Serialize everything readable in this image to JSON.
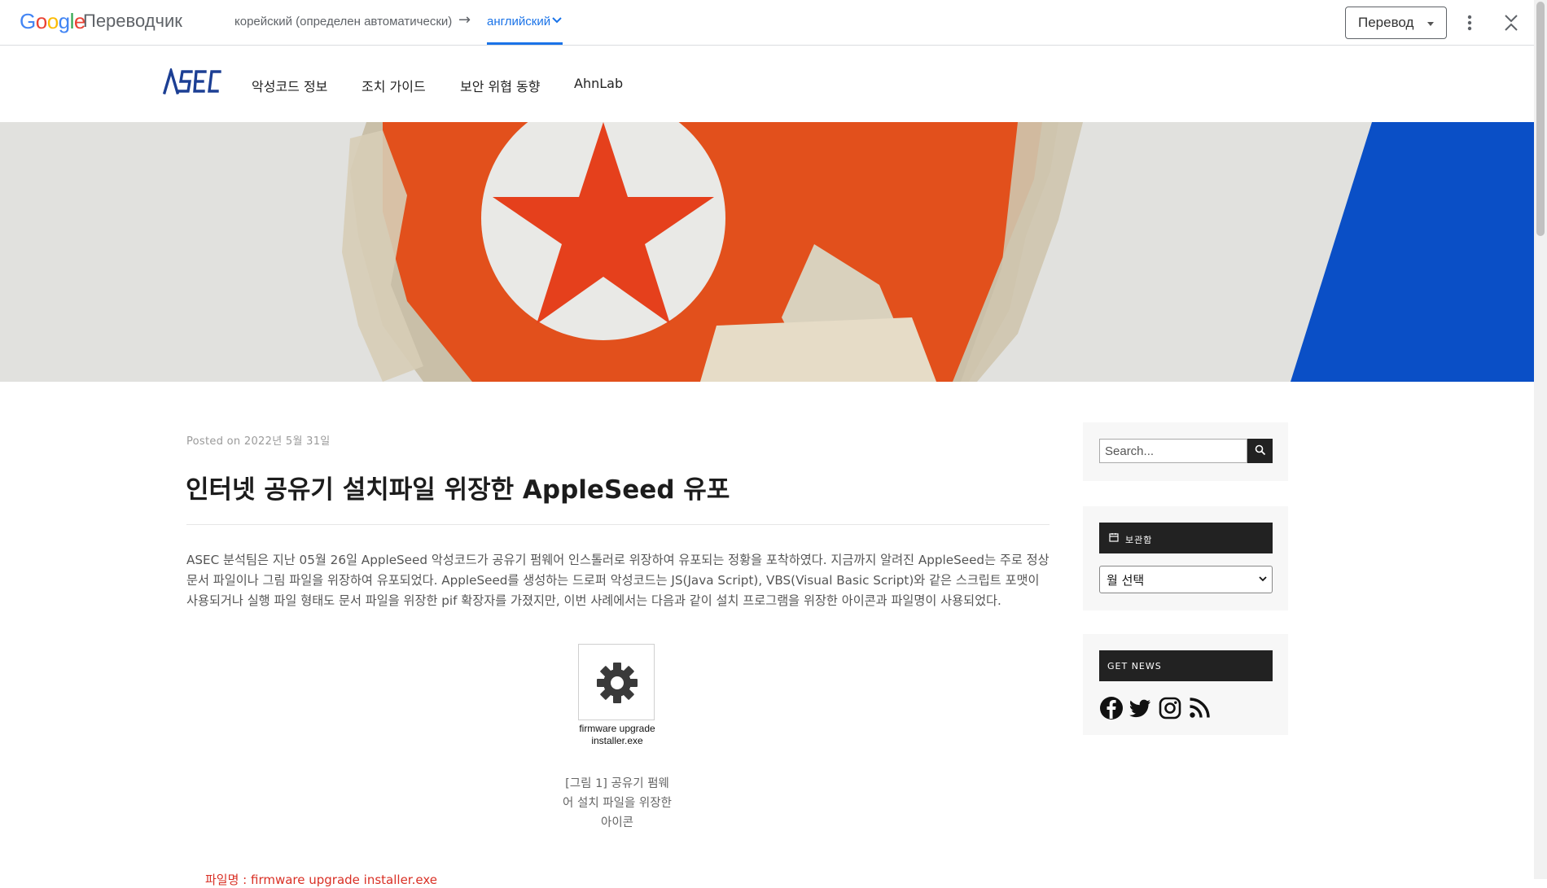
{
  "translate_bar": {
    "logo_letters": [
      "G",
      "o",
      "o",
      "g",
      "l",
      "e"
    ],
    "logo_colors": [
      "#4285F4",
      "#EA4335",
      "#FBBC05",
      "#4285F4",
      "#34A853",
      "#EA4335"
    ],
    "app_name": "Переводчик",
    "source_language": "корейский (определен автоматически)",
    "arrow": "→",
    "target_language": "английский",
    "translate_button": "Перевод",
    "accent_color": "#1a73e8"
  },
  "site": {
    "logo_text": "ASEC",
    "logo_color": "#1c3f94",
    "nav": [
      "악성코드 정보",
      "조치 가이드",
      "보안 위협 동향",
      "AhnLab"
    ]
  },
  "article": {
    "posted": "Posted on 2022년 5월 31일",
    "title": "인터넷 공유기 설치파일 위장한 AppleSeed 유포",
    "body": "ASEC 분석팀은 지난 05월 26일 AppleSeed 악성코드가 공유기 펌웨어 인스톨러로 위장하여 유포되는 정황을 포착하였다. 지금까지 알려진 AppleSeed는 주로 정상 문서 파일이나 그림 파일을 위장하여 유포되었다. AppleSeed를 생성하는 드로퍼 악성코드는 JS(Java Script), VBS(Visual Basic Script)와 같은 스크립트 포맷이 사용되거나 실행 파일 형태도 문서 파일을 위장한 pif 확장자를 가졌지만, 이번 사례에서는 다음과 같이 설치 프로그램을 위장한 아이콘과 파일명이 사용되었다.",
    "figure": {
      "file_name": "firmware upgrade installer.exe",
      "caption": "[그림 1] 공유기 펌웨어 설치 파일을 위장한 아이콘",
      "icon": "gear-icon"
    },
    "file_line": "파일명 : firmware upgrade installer.exe"
  },
  "sidebar": {
    "search_placeholder": "Search...",
    "archive_title": "보관함",
    "archive_select": "월 선택",
    "news_title": "GET NEWS",
    "social": [
      "facebook-icon",
      "twitter-icon",
      "instagram-icon",
      "rss-icon"
    ]
  }
}
